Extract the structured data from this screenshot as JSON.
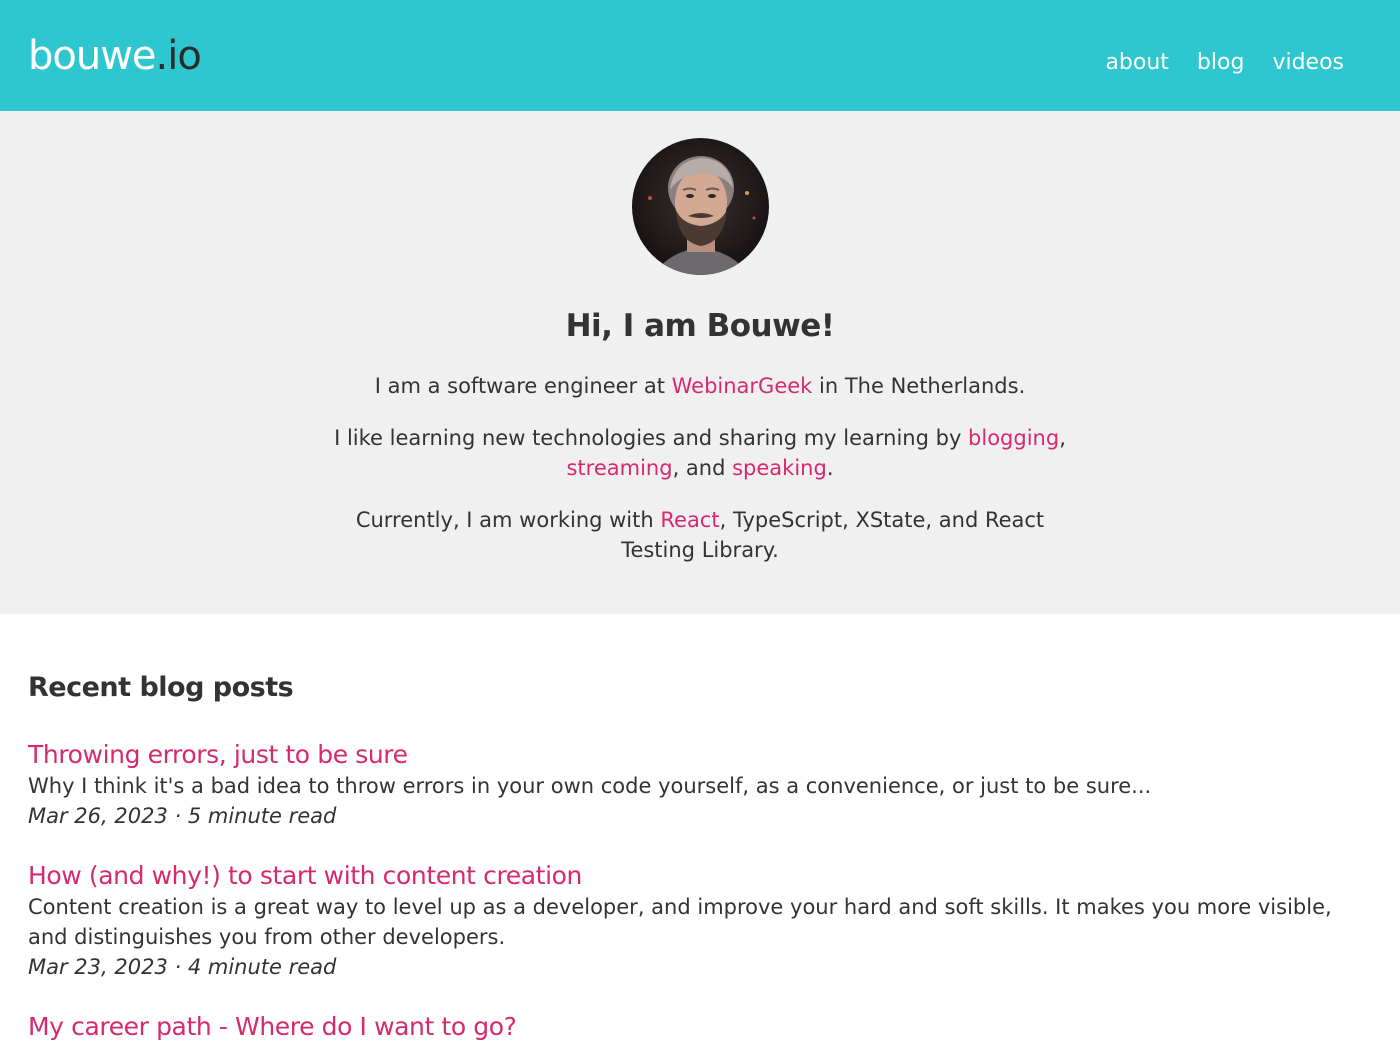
{
  "header": {
    "logo_main": "bouwe",
    "logo_tld": ".io",
    "nav": [
      {
        "label": "about"
      },
      {
        "label": "blog"
      },
      {
        "label": "videos"
      }
    ]
  },
  "hero": {
    "avatar_icon": "profile-photo",
    "title": "Hi, I am Bouwe!",
    "p1": {
      "before": "I am a software engineer at ",
      "link": "WebinarGeek",
      "after": " in The Netherlands."
    },
    "p2": {
      "before": "I like learning new technologies and sharing my learning by ",
      "link1": "blogging",
      "sep1": ",",
      "link2": "streaming",
      "sep2": ", and ",
      "link3": "speaking",
      "after": "."
    },
    "p3": {
      "before": "Currently, I am working with ",
      "link": "React",
      "after": ", TypeScript, XState, and React Testing Library."
    }
  },
  "blog": {
    "heading": "Recent blog posts",
    "posts": [
      {
        "title": "Throwing errors, just to be sure",
        "excerpt": "Why I think it's a bad idea to throw errors in your own code yourself, as a convenience, or just to be sure...",
        "meta": "Mar 26, 2023 · 5 minute read"
      },
      {
        "title": "How (and why!) to start with content creation",
        "excerpt": "Content creation is a great way to level up as a developer, and improve your hard and soft skills. It makes you more visible, and distinguishes you from other developers.",
        "meta": "Mar 23, 2023 · 4 minute read"
      },
      {
        "title": "My career path - Where do I want to go?",
        "excerpt": "",
        "meta": ""
      }
    ]
  },
  "colors": {
    "header_bg": "#2fc7cf",
    "hero_bg": "#f0f0f0",
    "link": "#d72a6e",
    "text": "#333333"
  }
}
